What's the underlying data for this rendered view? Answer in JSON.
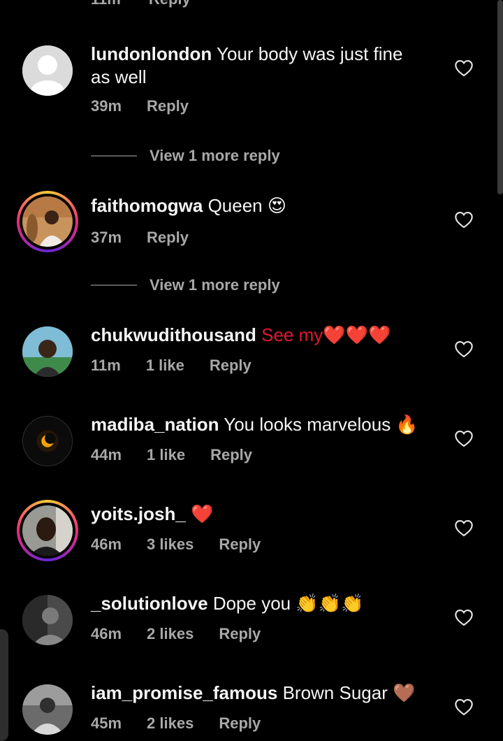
{
  "partial_top": {
    "time": "11m",
    "action": "Reply"
  },
  "comments": [
    {
      "username": "lundonlondon",
      "text": "Your body was just fine",
      "text2": "as well",
      "time": "39m",
      "likes": "",
      "reply": "Reply"
    },
    {
      "username": "faithomogwa",
      "text": "Queen 😍",
      "time": "37m",
      "likes": "",
      "reply": "Reply"
    },
    {
      "username": "chukwudithousand",
      "text": "See my❤️❤️❤️",
      "time": "11m",
      "likes": "1 like",
      "reply": "Reply"
    },
    {
      "username": "madiba_nation",
      "text": "You looks marvelous 🔥",
      "time": "44m",
      "likes": "1 like",
      "reply": "Reply"
    },
    {
      "username": "yoits.josh_",
      "text": "❤️",
      "time": "46m",
      "likes": "3 likes",
      "reply": "Reply"
    },
    {
      "username": "_solutionlove",
      "text": "Dope you 👏👏👏",
      "time": "46m",
      "likes": "2 likes",
      "reply": "Reply"
    },
    {
      "username": "iam_promise_famous",
      "text": "Brown Sugar 🤎",
      "time": "45m",
      "likes": "2 likes",
      "reply": "Reply"
    }
  ],
  "view_more": [
    {
      "label": "View 1 more reply"
    },
    {
      "label": "View 1 more reply"
    }
  ],
  "icons": {
    "like": "heart-outline-icon",
    "default_avatar": "person-silhouette-icon"
  },
  "colors": {
    "background": "#000000",
    "text": "#f5f5f5",
    "muted": "#a8a8a8",
    "story_ring_start": "#f9ce34",
    "story_ring_end": "#ee2a7b"
  }
}
